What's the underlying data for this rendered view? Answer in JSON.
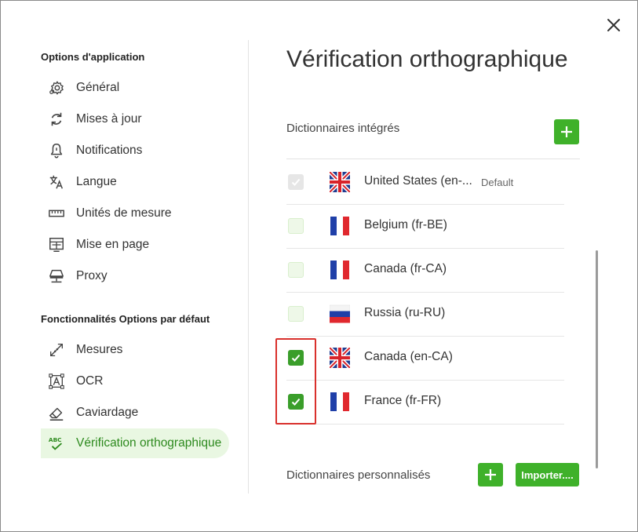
{
  "dialog": {
    "sidebar": {
      "section1_title": "Options d'application",
      "section2_title": "Fonctionnalités Options par défaut",
      "items": [
        {
          "label": "Général",
          "icon": "gear-icon"
        },
        {
          "label": "Mises à jour",
          "icon": "refresh-icon"
        },
        {
          "label": "Notifications",
          "icon": "bell-icon"
        },
        {
          "label": "Langue",
          "icon": "translate-icon"
        },
        {
          "label": "Unités de mesure",
          "icon": "ruler-icon"
        },
        {
          "label": "Mise en page",
          "icon": "page-layout-icon"
        },
        {
          "label": "Proxy",
          "icon": "proxy-icon"
        },
        {
          "label": "Mesures",
          "icon": "measure-icon"
        },
        {
          "label": "OCR",
          "icon": "ocr-icon"
        },
        {
          "label": "Caviardage",
          "icon": "eraser-icon"
        },
        {
          "label": "Vérification orthographique",
          "icon": "spellcheck-icon",
          "active": true
        }
      ]
    },
    "main": {
      "title": "Vérification orthographique",
      "builtin_title": "Dictionnaires intégrés",
      "custom_title": "Dictionnaires personnalisés",
      "import_label": "Importer....",
      "dictionaries": [
        {
          "label": "United States (en-...",
          "flag": "uk-flag-icon",
          "state": "disabled-checked",
          "default": "Default"
        },
        {
          "label": "Belgium (fr-BE)",
          "flag": "france-flag-icon",
          "state": "unchecked"
        },
        {
          "label": "Canada (fr-CA)",
          "flag": "france-flag-icon",
          "state": "unchecked"
        },
        {
          "label": "Russia (ru-RU)",
          "flag": "russia-flag-icon",
          "state": "unchecked"
        },
        {
          "label": "Canada (en-CA)",
          "flag": "uk-flag-icon",
          "state": "checked"
        },
        {
          "label": "France (fr-FR)",
          "flag": "france-flag-icon",
          "state": "checked"
        }
      ]
    },
    "colors": {
      "accent": "#3fb12a",
      "active_bg": "#e9f7e2",
      "active_text": "#2d8a1e",
      "highlight": "#d9302c"
    }
  }
}
